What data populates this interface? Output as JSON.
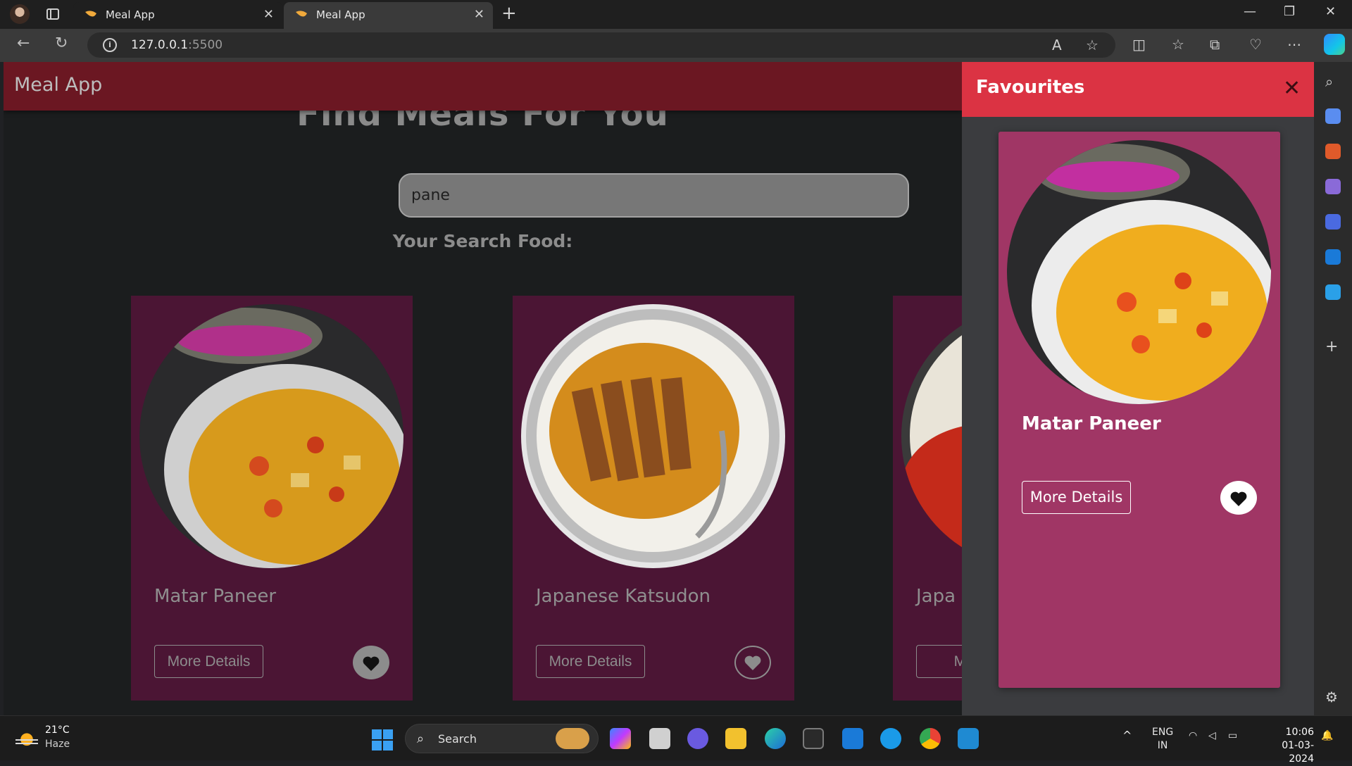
{
  "browser": {
    "tabs": [
      {
        "title": "Meal App"
      },
      {
        "title": "Meal App"
      }
    ],
    "url_host": "127.0.0.1",
    "url_port": ":5500"
  },
  "app": {
    "brand": "Meal App",
    "hero_title": "Find Meals For You",
    "search_value": "pane",
    "results_heading": "Your Search Food:",
    "results": [
      {
        "name": "Matar Paneer",
        "more_label": "More Details",
        "favourited": true
      },
      {
        "name": "Japanese Katsudon",
        "more_label": "More Details",
        "favourited": false
      },
      {
        "name": "Japa",
        "more_label": "More",
        "favourited": false
      }
    ]
  },
  "favourites": {
    "title": "Favourites",
    "items": [
      {
        "name": "Matar Paneer",
        "more_label": "More Details"
      }
    ]
  },
  "taskbar": {
    "temperature": "21°C",
    "weather": "Haze",
    "search_label": "Search",
    "language": "ENG",
    "region": "IN",
    "time": "10:06",
    "date": "01-03-2024"
  },
  "colors": {
    "header": "#6b1722",
    "drawer_header": "#db3343",
    "card": "#4b1534",
    "favourite_card": "#a03665"
  }
}
